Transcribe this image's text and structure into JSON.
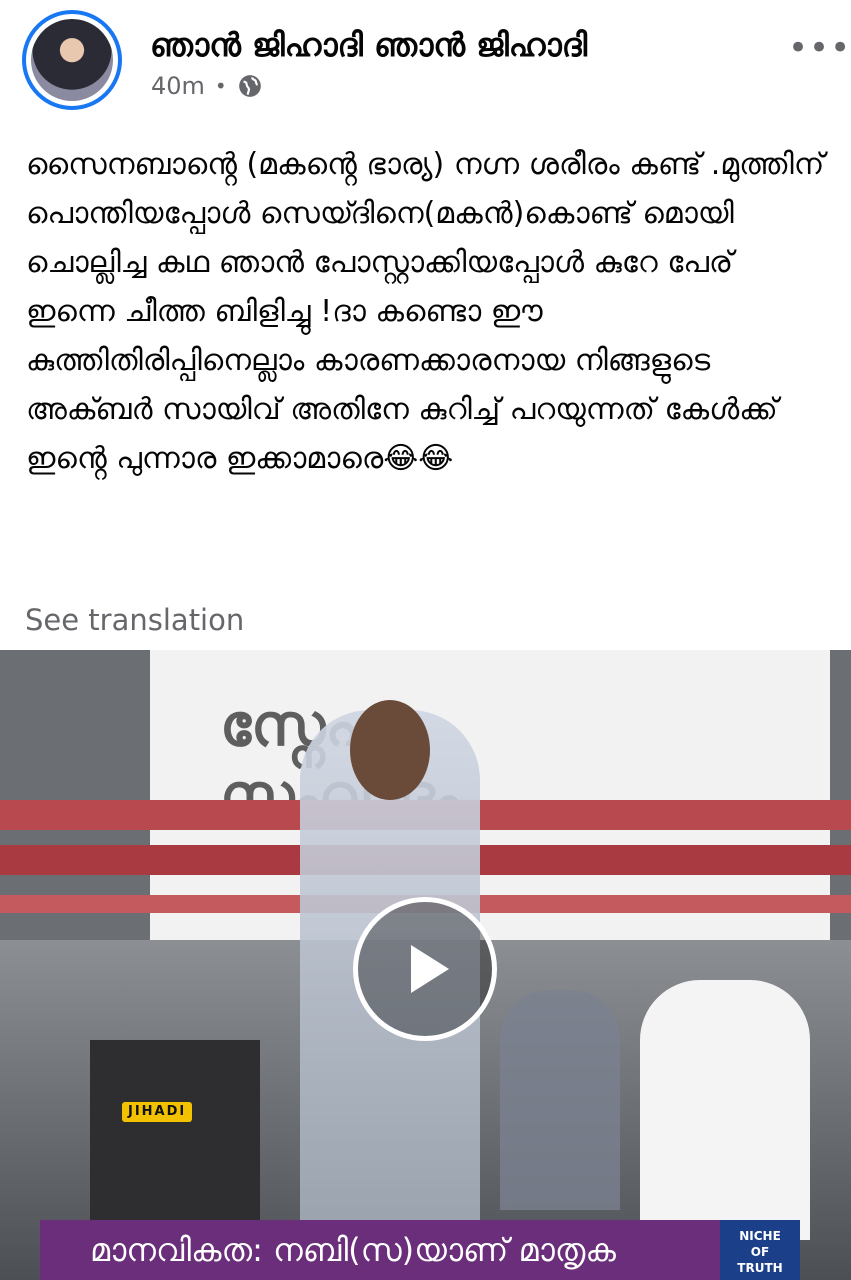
{
  "post": {
    "author": "ഞാൻ ജിഹാദി ഞാൻ ജിഹാദി",
    "time": "40m",
    "separator": "•",
    "privacy_icon": "globe-icon",
    "more_label": "•••",
    "text": "സൈനബാൻ്റെ (മകൻ്റെ ഭാര്യ) നഗ്ന ശരീരം കണ്ട് .മുത്തിന് പൊന്തിയപ്പോൾ സെയ്ദിനെ(മകൻ)കൊണ്ട് മൊയി ചൊല്ലിച്ച കഥ ഞാൻ പോസ്റ്റാക്കിയപ്പോൾ കുറേ പേര് ഇന്നെ ചീത്ത ബിളിച്ചു !ദാ കണ്ടൊ ഈ കുത്തിതിരിപ്പിനെല്ലാം കാരണക്കാരനായ നിങ്ങളുടെ അക്ബർ സായിവ് അതിനേ കുറിച്ച് പറയുന്നത് കേൾക്ക് ഇൻ്റെ പുന്നാര ഇക്കാമാരെ😂😂",
    "see_translation": "See translation"
  },
  "video": {
    "banner_title_1": "സ്നേഹ",
    "banner_title_2": "സംവാദം",
    "watermark": "JIHADI",
    "caption": "മാനവികത: നബി(സ)യാണ് മാതൃക",
    "channel_logo_1": "NICHE",
    "channel_logo_2": "OF",
    "channel_logo_3": "TRUTH",
    "play_icon": "play-icon"
  },
  "colors": {
    "accent": "#1877f2",
    "secondary_text": "#65676b",
    "caption_bg": "#6a2e7a"
  }
}
